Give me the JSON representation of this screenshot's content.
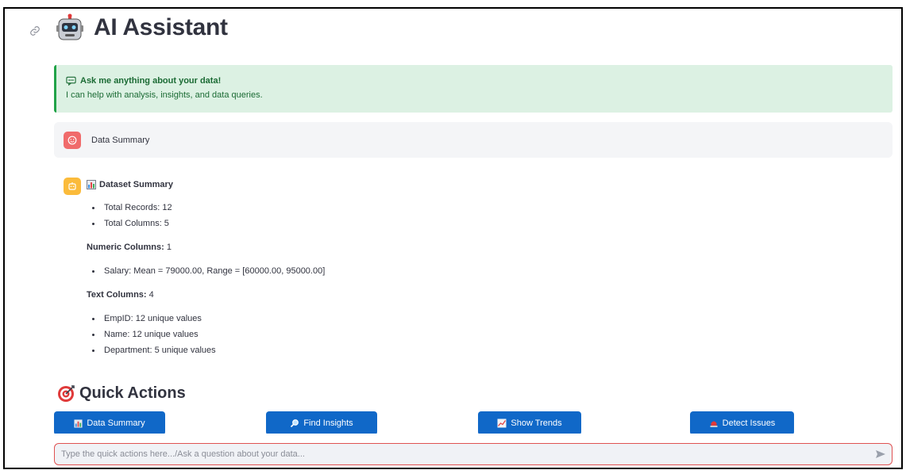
{
  "app": {
    "title": "AI Assistant"
  },
  "alert": {
    "heading": "Ask me anything about your data!",
    "body": "I can help with analysis, insights, and data queries."
  },
  "chat": {
    "user_message": "Data Summary",
    "bot": {
      "heading": "Dataset Summary",
      "overview": [
        "Total Records: 12",
        "Total Columns: 5"
      ],
      "numeric_label": "Numeric Columns:",
      "numeric_count": "1",
      "numeric_items": [
        "Salary: Mean = 79000.00, Range = [60000.00, 95000.00]"
      ],
      "text_label": "Text Columns:",
      "text_count": "4",
      "text_items": [
        "EmpID: 12 unique values",
        "Name: 12 unique values",
        "Department: 5 unique values"
      ]
    }
  },
  "quick_actions": {
    "title": "Quick Actions",
    "buttons": [
      {
        "label": "Data Summary",
        "icon": "bar-chart-icon"
      },
      {
        "label": "Find Insights",
        "icon": "magnifier-icon"
      },
      {
        "label": "Show Trends",
        "icon": "trend-chart-icon"
      },
      {
        "label": "Detect Issues",
        "icon": "siren-icon"
      }
    ]
  },
  "input": {
    "placeholder": "Type the quick actions here.../Ask a question about your data..."
  },
  "colors": {
    "accent": "#1068c8",
    "alert_bg": "#dcf1e3",
    "alert_text": "#1b6b34",
    "input_border": "#e05252"
  }
}
